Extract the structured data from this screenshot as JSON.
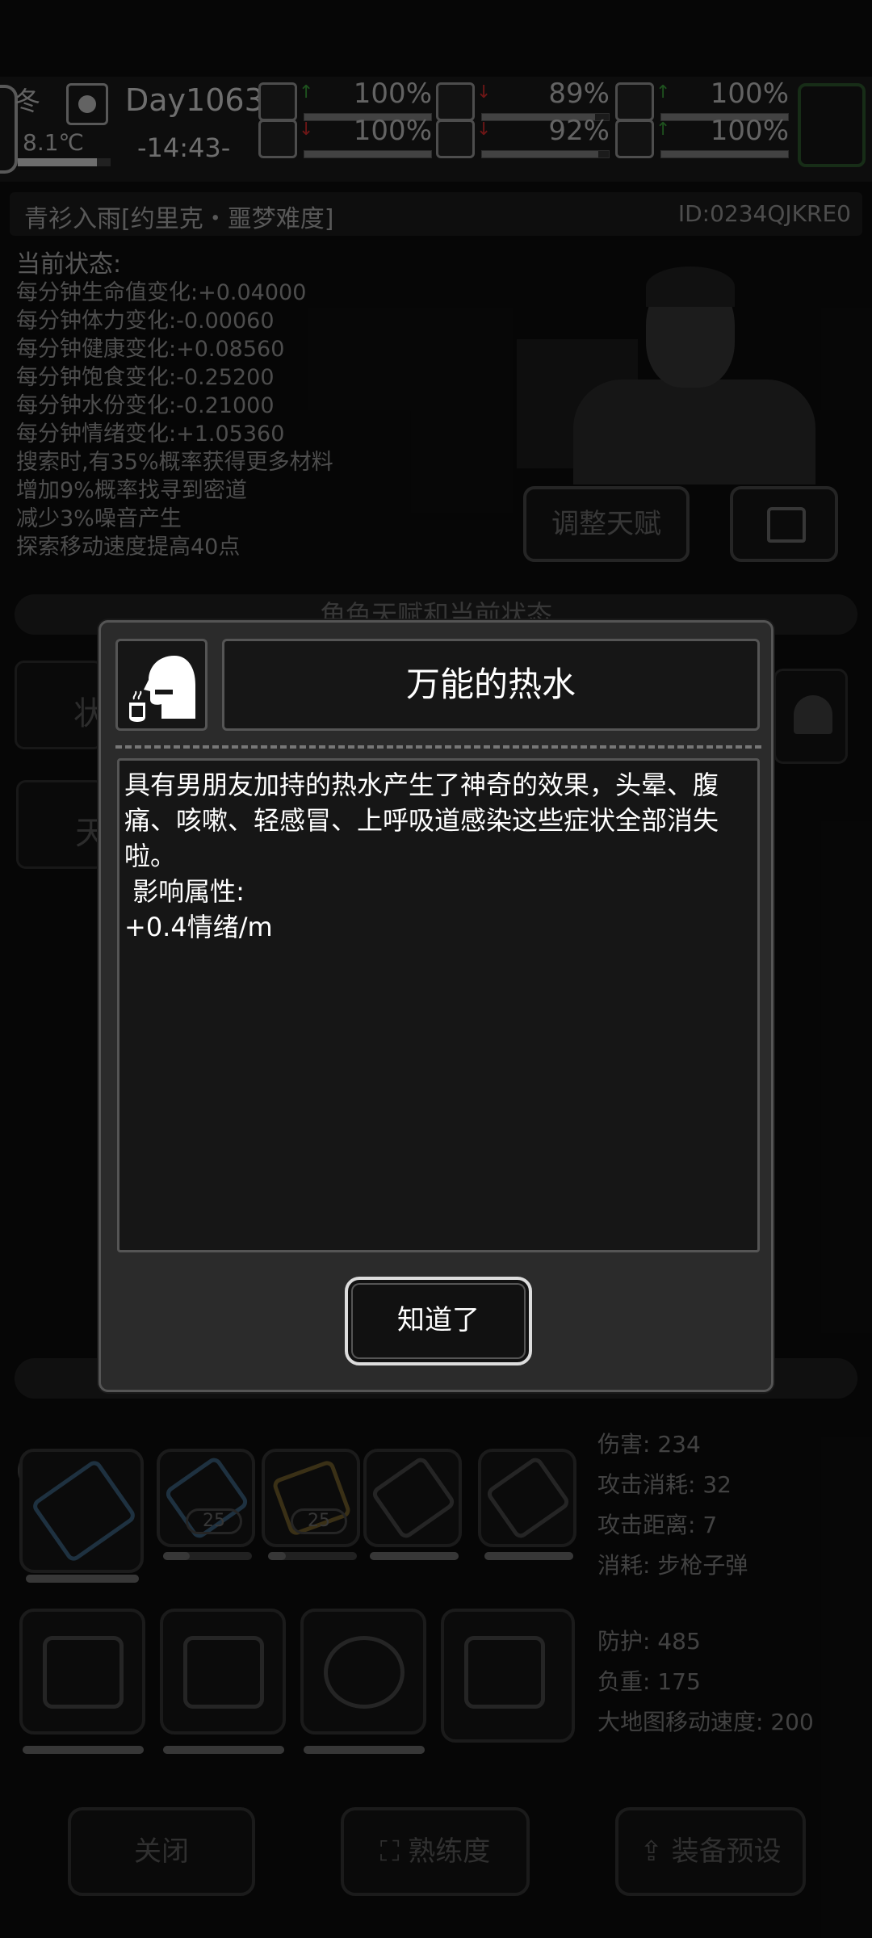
{
  "hud": {
    "season": "冬",
    "temperature": "8.1℃",
    "temperature_level": 0.85,
    "day": "Day1063",
    "time": "-14:43-",
    "stats": [
      {
        "name": "medkit-icon",
        "trend": "up",
        "value": "100%",
        "level": 1.0
      },
      {
        "name": "stomach-icon",
        "trend": "down",
        "value": "89%",
        "level": 0.89
      },
      {
        "name": "stamina-icon",
        "trend": "up",
        "value": "100%",
        "level": 1.0
      },
      {
        "name": "boot-icon",
        "trend": "down",
        "value": "100%",
        "level": 1.0
      },
      {
        "name": "water-icon",
        "trend": "down",
        "value": "92%",
        "level": 0.92
      },
      {
        "name": "heart-icon",
        "trend": "up",
        "value": "100%",
        "level": 1.0
      }
    ],
    "arrow_colors": {
      "up": "#2f7f2f",
      "down": "#a22222"
    }
  },
  "character": {
    "name": "青衫入雨[约里克・噩梦难度]",
    "id": "ID:0234QJKRE0"
  },
  "status": {
    "title": "当前状态:",
    "lines": [
      "每分钟生命值变化:+0.04000",
      "每分钟体力变化:-0.00060",
      "每分钟健康变化:+0.08560",
      "每分钟饱食变化:-0.25200",
      "每分钟水份变化:-0.21000",
      "每分钟情绪变化:+1.05360",
      "搜索时,有35%概率获得更多材料",
      "增加9%概率找寻到密道",
      "减少3%噪音产生",
      "探索移动速度提高40点"
    ],
    "adjust_talent_button": "调整天赋"
  },
  "background_labels": {
    "talent_bar": "角色天赋和当前状态",
    "ghost_1": "状",
    "ghost_2": "天"
  },
  "weapon_slots": [
    {
      "name": "minigun",
      "count": "",
      "durability": 1.0
    },
    {
      "name": "rifle",
      "count": "25",
      "durability": 0.3
    },
    {
      "name": "ammo-belt",
      "count": "25",
      "durability": 0.2
    },
    {
      "name": "fist",
      "count": "",
      "durability": 1.0
    },
    {
      "name": "flashlight",
      "count": "",
      "durability": 1.0
    }
  ],
  "weapon_info": [
    "伤害: 234",
    "攻击消耗: 32",
    "攻击距离: 7",
    "消耗: 步枪子弹"
  ],
  "armor_slots": [
    {
      "name": "backpack-tools",
      "durability": 1.0
    },
    {
      "name": "body-armor",
      "durability": 1.0
    },
    {
      "name": "helmet",
      "durability": 1.0
    },
    {
      "name": "vehicle",
      "durability": 0
    }
  ],
  "armor_info": [
    "防护: 485",
    "负重: 175",
    "大地图移动速度: 200"
  ],
  "bottom_buttons": {
    "close": "关闭",
    "proficiency": "熟练度",
    "equipment_preset": "装备预设"
  },
  "modal": {
    "title": "万能的热水",
    "description": "具有男朋友加持的热水产生了神奇的效果，头晕、腹痛、咳嗽、轻感冒、上呼吸道感染这些症状全部消失啦。",
    "attr_label": " 影响属性:",
    "attr_value": "+0.4情绪/m",
    "confirm_button": "知道了"
  }
}
